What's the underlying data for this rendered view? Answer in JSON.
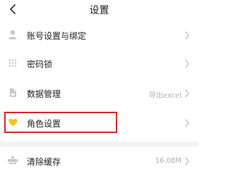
{
  "header": {
    "title": "设置"
  },
  "rows": [
    {
      "label": "账号设置与绑定",
      "value": "",
      "icon": "user-icon"
    },
    {
      "label": "密码锁",
      "value": "",
      "icon": "grid-dots-icon"
    },
    {
      "label": "数据管理",
      "value": "导出excel",
      "icon": "document-icon"
    },
    {
      "label": "角色设置",
      "value": "",
      "icon": "heart-icon"
    },
    {
      "label": "清除缓存",
      "value": "16.08M",
      "icon": "broom-icon"
    }
  ],
  "colors": {
    "highlight_border": "#d9252a",
    "heart": "#f4c21f",
    "icon_gray": "#c6c8cc"
  }
}
